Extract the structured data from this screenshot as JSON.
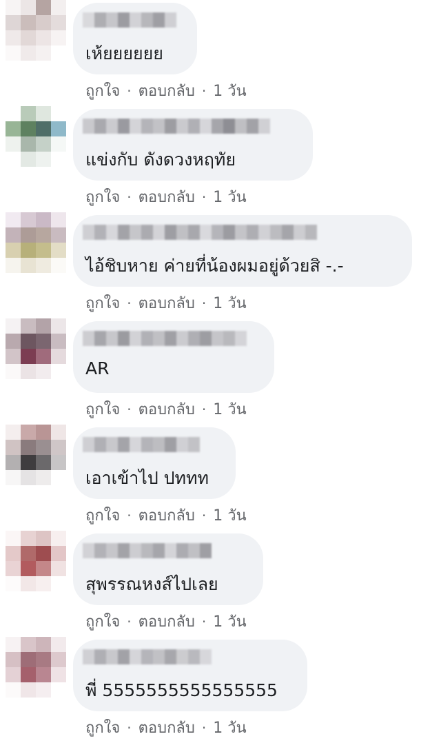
{
  "comments": [
    {
      "text": "เห้ยยยยยย",
      "like_label": "ถูกใจ",
      "reply_label": "ตอบกลับ",
      "time": "1 วัน"
    },
    {
      "text": "แข่งกับ ดังดวงหฤทัย",
      "like_label": "ถูกใจ",
      "reply_label": "ตอบกลับ",
      "time": "1 วัน"
    },
    {
      "text": "ไอ้ชิบหาย ค่ายที่น้องผมอยู่ด้วยสิ -.-",
      "like_label": "ถูกใจ",
      "reply_label": "ตอบกลับ",
      "time": "1 วัน"
    },
    {
      "text": "AR",
      "like_label": "ถูกใจ",
      "reply_label": "ตอบกลับ",
      "time": "1 วัน"
    },
    {
      "text": "เอาเข้าไป ปททท",
      "like_label": "ถูกใจ",
      "reply_label": "ตอบกลับ",
      "time": "1 วัน"
    },
    {
      "text": "สุพรรณหงส์ไปเลย",
      "like_label": "ถูกใจ",
      "reply_label": "ตอบกลับ",
      "time": "1 วัน"
    },
    {
      "text": "พี่ 5555555555555555",
      "like_label": "ถูกใจ",
      "reply_label": "ตอบกลับ",
      "time": "1 วัน"
    }
  ],
  "colors": {
    "bubble": "#f0f2f5",
    "text": "#1c1e21",
    "meta": "#65676b"
  }
}
